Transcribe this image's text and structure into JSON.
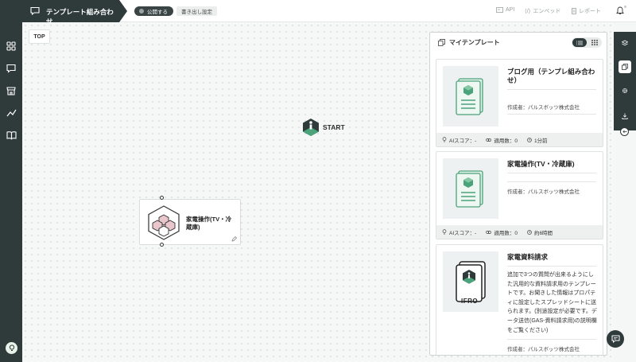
{
  "header": {
    "title": "テンプレート組み合わせ",
    "publish_label": "公開する",
    "export_label": "書き出し設定",
    "api_label": "API",
    "embed_label": "エンベッド",
    "report_label": "レポート"
  },
  "canvas": {
    "top_button": "TOP",
    "start_label": "START",
    "node_label": "家電操作(TV・冷蔵庫)"
  },
  "panel": {
    "title": "マイテンプレート",
    "cards": [
      {
        "title": "ブログ用（テンプレ組み合わせ）",
        "author": "作成者：パルスボッツ株式会社",
        "ai_score": "AIスコア：-",
        "usage": "適用数：0",
        "time": "1分前"
      },
      {
        "title": "家電操作(TV・冷蔵庫)",
        "author": "作成者：パルスボッツ株式会社",
        "ai_score": "AIスコア：-",
        "usage": "適用数：0",
        "time": "約6時間"
      },
      {
        "title": "家電資料請求",
        "description": "追加で3つの質問が出来るようにした汎用的な資料請求用のテンプレートです。お聞きした情報はプロパティに設定したスプレッドシートに送られます。(別途設定が必要です。データ送信(GAS-資料請求用)の説明欄をご覧ください)",
        "author": "作成者：パルスボッツ株式会社",
        "badge_text": "IFRO"
      }
    ]
  },
  "colors": {
    "dark": "#2f3b3b",
    "accent_green": "#4aa37a",
    "canvas_bg": "#f6f7f7"
  },
  "icons": {
    "title": "chat-bubble-icon",
    "sidebar": [
      "grid-icon",
      "chat-icon",
      "store-icon",
      "analytics-icon",
      "book-icon",
      "bulb-icon"
    ],
    "right_toolbar": [
      "layers-icon",
      "template-icon",
      "settings-icon",
      "download-icon"
    ]
  }
}
